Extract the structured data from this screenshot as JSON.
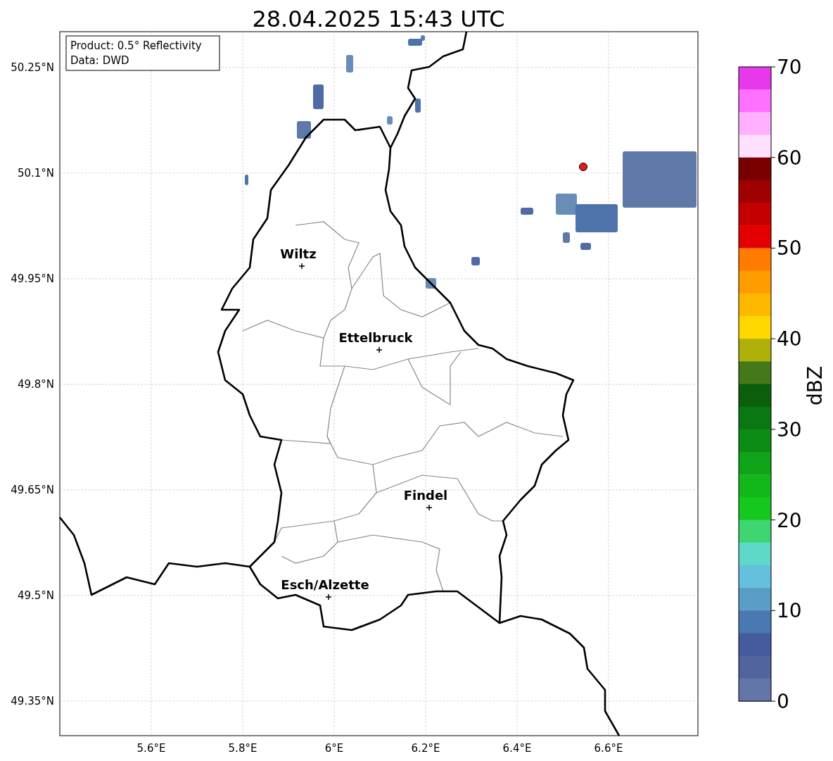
{
  "title": "28.04.2025 15:43 UTC",
  "map": {
    "info_box": [
      "Product: 0.5° Reflectivity",
      "Data: DWD"
    ],
    "latitude_labels": [
      "50.25°N",
      "50.1°N",
      "49.95°N",
      "49.8°N",
      "49.65°N",
      "49.5°N",
      "49.35°N"
    ],
    "longitude_labels": [
      "5.6°E",
      "5.8°E",
      "6°E",
      "6.2°E",
      "6.4°E",
      "6.6°E"
    ],
    "cities": [
      {
        "name": "Wiltz"
      },
      {
        "name": "Ettelbruck"
      },
      {
        "name": "Findel"
      },
      {
        "name": "Esch/Alzette"
      }
    ]
  },
  "colorbar": {
    "label": "dBZ",
    "ticks": [
      "70",
      "60",
      "50",
      "40",
      "30",
      "20",
      "10",
      "0"
    ],
    "segments": [
      {
        "color": "#e838ec"
      },
      {
        "color": "#ff70ff"
      },
      {
        "color": "#ffb0ff"
      },
      {
        "color": "#ffe0ff"
      },
      {
        "color": "#780000"
      },
      {
        "color": "#a00000"
      },
      {
        "color": "#c40000"
      },
      {
        "color": "#e40000"
      },
      {
        "color": "#ff7c00"
      },
      {
        "color": "#ff9c00"
      },
      {
        "color": "#ffb800"
      },
      {
        "color": "#ffd800"
      },
      {
        "color": "#b0b00a"
      },
      {
        "color": "#447818"
      },
      {
        "color": "#0a5e0c"
      },
      {
        "color": "#0a7812"
      },
      {
        "color": "#0c8c14"
      },
      {
        "color": "#10a418"
      },
      {
        "color": "#12b81a"
      },
      {
        "color": "#14c81e"
      },
      {
        "color": "#3dd670"
      },
      {
        "color": "#5ed8c8"
      },
      {
        "color": "#64c0dc"
      },
      {
        "color": "#5a9ec8"
      },
      {
        "color": "#4a78b0"
      },
      {
        "color": "#445c9e"
      },
      {
        "color": "#52649e"
      },
      {
        "color": "#6475a8"
      }
    ]
  }
}
